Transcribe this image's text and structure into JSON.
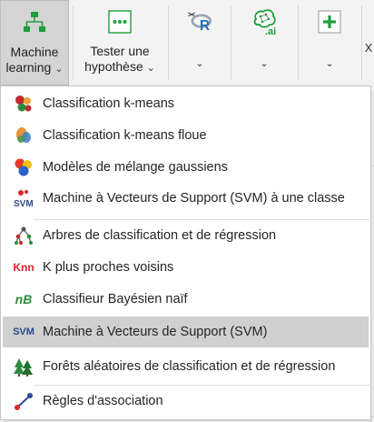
{
  "ribbon": {
    "machine_learning": {
      "line1": "Machine",
      "line2": "learning",
      "chevron": "⌄"
    },
    "tester": {
      "line1": "Tester une",
      "line2": "hypothèse",
      "chevron": "⌄"
    },
    "r_button": {
      "chevron": "⌄"
    },
    "ai_button": {
      "text": ".ai",
      "chevron": "⌄"
    },
    "add_button": {
      "chevron": "⌄"
    },
    "cut_off_text": "X"
  },
  "menu": {
    "items": [
      {
        "label": "Classification k-means",
        "icon": "kmeans-clusters-icon"
      },
      {
        "label": "Classification k-means floue",
        "icon": "fuzzy-kmeans-icon"
      },
      {
        "label": "Modèles de mélange gaussiens",
        "icon": "gaussian-mixture-icon"
      },
      {
        "label": "Machine à Vecteurs de Support (SVM) à une classe",
        "icon": "svm-one-class-icon",
        "icon_text": "SVM"
      },
      {
        "label": "Arbres de classification et de régression",
        "icon": "decision-tree-icon"
      },
      {
        "label": "K plus proches voisins",
        "icon": "knn-icon",
        "icon_text": "Knn"
      },
      {
        "label": "Classifieur Bayésien naïf",
        "icon": "naive-bayes-icon",
        "icon_text": "nB"
      },
      {
        "label": "Machine à Vecteurs de Support (SVM)",
        "icon": "svm-icon",
        "icon_text": "SVM"
      },
      {
        "label": "Forêts aléatoires de classification et de régression",
        "icon": "random-forest-icon"
      },
      {
        "label": "Règles d'association",
        "icon": "association-rules-icon"
      }
    ],
    "selected_index": 7
  },
  "colors": {
    "accent_green": "#1e9e3e",
    "selected_bg": "#d0d0d0",
    "knn_red": "#d9262c",
    "nb_green": "#2d8c3c",
    "svm_blue": "#2b4a8c"
  }
}
